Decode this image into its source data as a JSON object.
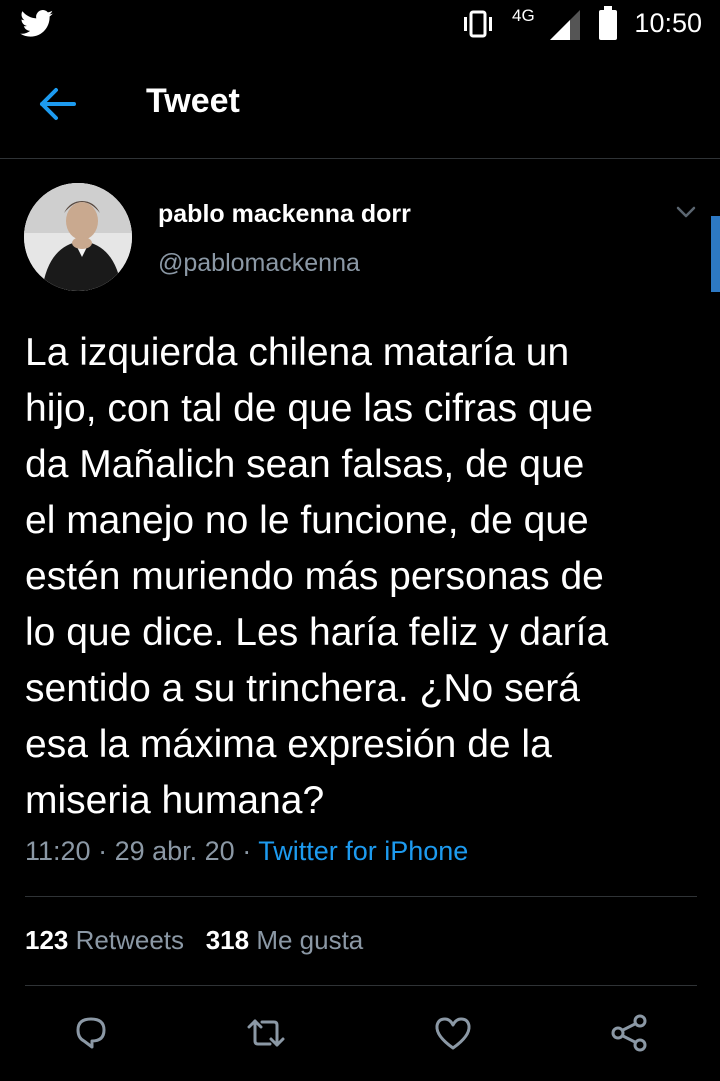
{
  "status_bar": {
    "network": "4G",
    "time": "10:50"
  },
  "header": {
    "title": "Tweet"
  },
  "author": {
    "name": "pablo mackenna dorr",
    "handle": "@pablomackenna"
  },
  "tweet": {
    "lines": [
      "La izquierda chilena mataría un",
      "hijo, con tal de que las cifras que",
      "da Mañalich sean falsas, de que",
      "el manejo no le funcione, de que",
      "estén muriendo más personas de",
      "lo que dice. Les haría feliz y daría",
      "sentido a su trinchera. ¿No será",
      "esa la máxima expresión de la",
      "miseria humana?"
    ],
    "time": "11:20",
    "date": "29 abr. 20",
    "source": "Twitter for iPhone",
    "sep": "·"
  },
  "stats": {
    "retweets_count": "123",
    "retweets_label": "Retweets",
    "likes_count": "318",
    "likes_label": "Me gusta"
  },
  "icons": {
    "back": "arrow-left-icon",
    "reply": "reply-icon",
    "retweet": "retweet-icon",
    "like": "heart-icon",
    "share": "share-icon"
  },
  "colors": {
    "accent": "#1d9bf0",
    "muted": "#8b98a5",
    "background": "#000000"
  }
}
